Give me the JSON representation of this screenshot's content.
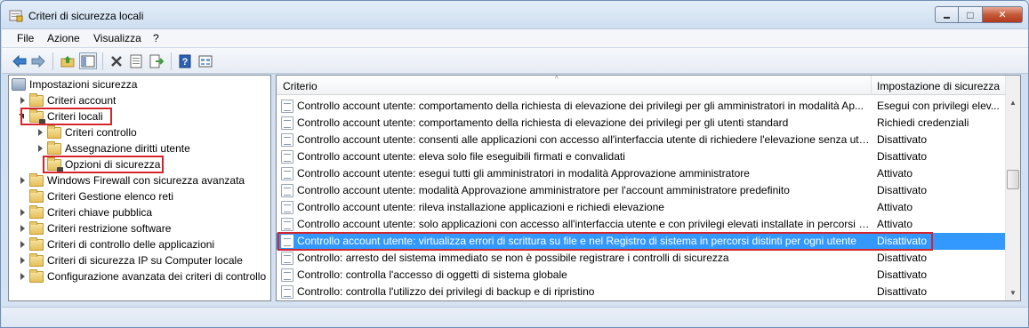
{
  "window": {
    "title": "Criteri di sicurezza locali",
    "minimize": "▬",
    "maximize": "□",
    "close": "✕"
  },
  "menu": [
    "File",
    "Azione",
    "Visualizza",
    "?"
  ],
  "toolbar": [
    "back-icon",
    "forward-icon",
    "up-folder-icon",
    "show-tree-icon",
    "delete-icon",
    "properties-icon",
    "export-icon",
    "help-icon",
    "view-icon"
  ],
  "tree": {
    "root": "Impostazioni sicurezza",
    "items": [
      {
        "label": "Criteri account",
        "level": 1,
        "twisty": "closed"
      },
      {
        "label": "Criteri locali",
        "level": 1,
        "twisty": "open",
        "highlight": true
      },
      {
        "label": "Criteri controllo",
        "level": 2,
        "twisty": "closed"
      },
      {
        "label": "Assegnazione diritti utente",
        "level": 2,
        "twisty": "closed"
      },
      {
        "label": "Opzioni di sicurezza",
        "level": 2,
        "twisty": "none",
        "highlight": true
      },
      {
        "label": "Windows Firewall con sicurezza avanzata",
        "level": 1,
        "twisty": "closed"
      },
      {
        "label": "Criteri Gestione elenco reti",
        "level": 1,
        "twisty": "none"
      },
      {
        "label": "Criteri chiave pubblica",
        "level": 1,
        "twisty": "closed"
      },
      {
        "label": "Criteri restrizione software",
        "level": 1,
        "twisty": "closed"
      },
      {
        "label": "Criteri di controllo delle applicazioni",
        "level": 1,
        "twisty": "closed"
      },
      {
        "label": "Criteri di sicurezza IP su Computer locale",
        "level": 1,
        "twisty": "closed"
      },
      {
        "label": "Configurazione avanzata dei criteri di controllo",
        "level": 1,
        "twisty": "closed"
      }
    ]
  },
  "list": {
    "columns": {
      "policy": "Criterio",
      "setting": "Impostazione di sicurezza"
    },
    "rows": [
      {
        "policy": "Controllo account utente: comportamento della richiesta di elevazione dei privilegi per gli amministratori in modalità Ap...",
        "setting": "Esegui con privilegi elev..."
      },
      {
        "policy": "Controllo account utente: comportamento della richiesta di elevazione dei privilegi per gli utenti standard",
        "setting": "Richiedi credenziali"
      },
      {
        "policy": "Controllo account utente: consenti alle applicazioni con accesso all'interfaccia utente di richiedere l'elevazione senza utili...",
        "setting": "Disattivato"
      },
      {
        "policy": "Controllo account utente: eleva solo file eseguibili firmati e convalidati",
        "setting": "Disattivato"
      },
      {
        "policy": "Controllo account utente: esegui tutti gli amministratori in modalità Approvazione amministratore",
        "setting": "Attivato"
      },
      {
        "policy": "Controllo account utente: modalità Approvazione amministratore per l'account amministratore predefinito",
        "setting": "Disattivato"
      },
      {
        "policy": "Controllo account utente: rileva installazione applicazioni e richiedi elevazione",
        "setting": "Attivato"
      },
      {
        "policy": "Controllo account utente: solo applicazioni con accesso all'interfaccia utente e con privilegi elevati installate in percorsi s...",
        "setting": "Attivato"
      },
      {
        "policy": "Controllo account utente: virtualizza errori di scrittura su file e nel Registro di sistema in percorsi distinti per ogni utente",
        "setting": "Disattivato",
        "selected": true
      },
      {
        "policy": "Controllo: arresto del sistema immediato se non è possibile registrare i controlli di sicurezza",
        "setting": "Disattivato"
      },
      {
        "policy": "Controllo: controlla l'accesso di oggetti di sistema globale",
        "setting": "Disattivato"
      },
      {
        "policy": "Controllo: controlla l'utilizzo dei privilegi di backup e di ripristino",
        "setting": "Disattivato"
      }
    ]
  },
  "colors": {
    "selection": "#3399ff",
    "highlight_box": "#d4252c"
  }
}
